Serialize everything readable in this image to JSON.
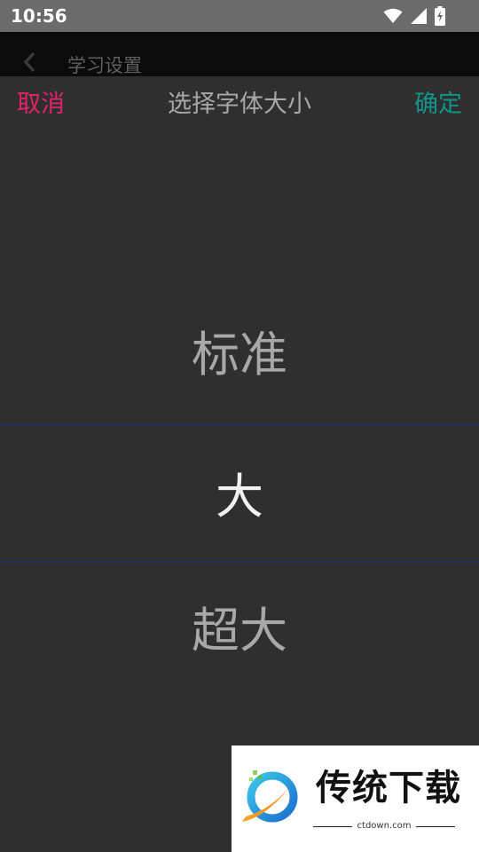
{
  "status_bar": {
    "time": "10:56",
    "icons": [
      "wifi-icon",
      "signal-icon",
      "battery-charging-icon"
    ]
  },
  "app_bar": {
    "back_icon": "chevron-left-icon",
    "title": "学习设置"
  },
  "picker": {
    "cancel_label": "取消",
    "title": "选择字体大小",
    "confirm_label": "确定",
    "options": [
      "标准",
      "大",
      "超大"
    ],
    "selected_value": "大"
  },
  "watermark": {
    "text": "传统下载",
    "domain": "ctdown.com"
  },
  "colors": {
    "cancel": "#e2236a",
    "confirm": "#11948a",
    "sheet_background": "#2f2f2f",
    "selection_lines": "#2a2c8c"
  }
}
